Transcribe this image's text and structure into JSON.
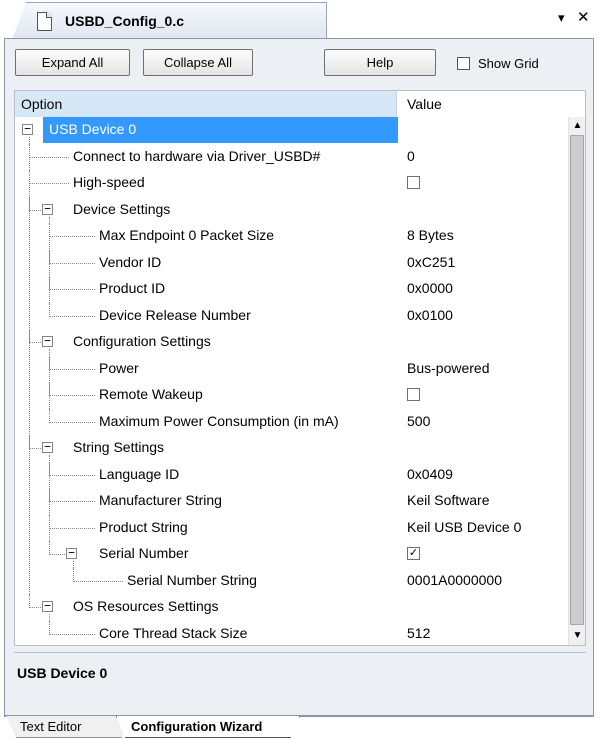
{
  "document_tab": {
    "title": "USBD_Config_0.c",
    "menu_glyph": "▾",
    "close_glyph": "✕"
  },
  "toolbar": {
    "expand_all": "Expand All",
    "collapse_all": "Collapse All",
    "help": "Help",
    "show_grid": "Show Grid",
    "show_grid_checked": false
  },
  "grid": {
    "header_option": "Option",
    "header_value": "Value",
    "rows": [
      {
        "name": "USB Device 0",
        "value": "",
        "level": 0,
        "expander": "−",
        "selected": true
      },
      {
        "name": "Connect to hardware via Driver_USBD#",
        "value": "0",
        "level": 1
      },
      {
        "name": "High-speed",
        "value": "",
        "level": 1,
        "checkbox": false
      },
      {
        "name": "Device Settings",
        "value": "",
        "level": 1,
        "expander": "−"
      },
      {
        "name": "Max Endpoint 0 Packet Size",
        "value": "8 Bytes",
        "level": 2
      },
      {
        "name": "Vendor ID",
        "value": "0xC251",
        "level": 2
      },
      {
        "name": "Product ID",
        "value": "0x0000",
        "level": 2
      },
      {
        "name": "Device Release Number",
        "value": "0x0100",
        "level": 2
      },
      {
        "name": "Configuration Settings",
        "value": "",
        "level": 1,
        "expander": "−"
      },
      {
        "name": "Power",
        "value": "Bus-powered",
        "level": 2
      },
      {
        "name": "Remote Wakeup",
        "value": "",
        "level": 2,
        "checkbox": false
      },
      {
        "name": "Maximum Power Consumption (in mA)",
        "value": "500",
        "level": 2
      },
      {
        "name": "String Settings",
        "value": "",
        "level": 1,
        "expander": "−"
      },
      {
        "name": "Language ID",
        "value": "0x0409",
        "level": 2
      },
      {
        "name": "Manufacturer String",
        "value": "Keil Software",
        "level": 2
      },
      {
        "name": "Product String",
        "value": "Keil USB Device 0",
        "level": 2
      },
      {
        "name": "Serial Number",
        "value": "",
        "level": 2,
        "expander": "−",
        "checkbox": true
      },
      {
        "name": "Serial Number String",
        "value": "0001A0000000",
        "level": 3
      },
      {
        "name": "OS Resources Settings",
        "value": "",
        "level": 1,
        "expander": "−"
      },
      {
        "name": "Core Thread Stack Size",
        "value": "512",
        "level": 2
      }
    ]
  },
  "scrollbar": {
    "up_glyph": "▲",
    "down_glyph": "▼"
  },
  "description": {
    "title": "USB Device 0"
  },
  "bottom_tabs": [
    {
      "label": "Text Editor",
      "active": false
    },
    {
      "label": "Configuration Wizard",
      "active": true
    }
  ],
  "colors": {
    "selection": "#3399ff",
    "header_option_bg": "#d6e7f7",
    "chrome": "#eceff3"
  }
}
